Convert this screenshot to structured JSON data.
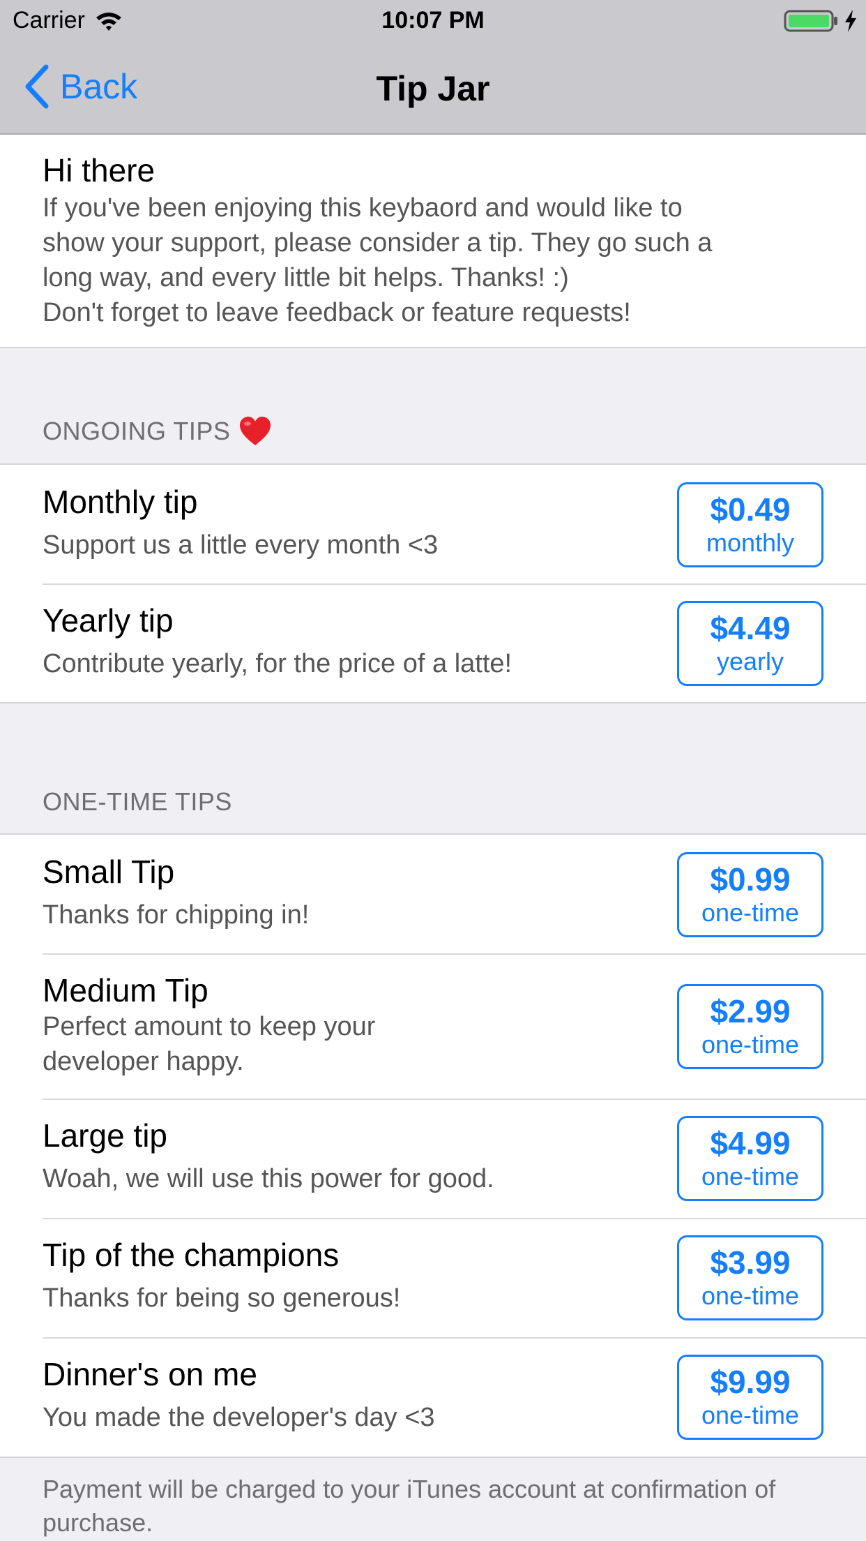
{
  "status_bar": {
    "carrier": "Carrier",
    "time": "10:07 PM",
    "battery_color": "#4cd964"
  },
  "nav": {
    "back_label": "Back",
    "title": "Tip Jar",
    "accent_color": "#147efb"
  },
  "intro": {
    "title": "Hi there",
    "body": "If you've been enjoying this keybaord and would like to\nshow your support, please consider a tip. They go such a\nlong way, and every little bit helps. Thanks! :)\nDon't forget to leave feedback or feature requests!"
  },
  "sections": [
    {
      "header": "ONGOING TIPS",
      "header_icon": "heart-icon",
      "items": [
        {
          "title": "Monthly tip",
          "subtitle": "Support us a little every month <3",
          "price": "$0.49",
          "period": "monthly"
        },
        {
          "title": "Yearly tip",
          "subtitle": "Contribute yearly, for the price of a latte!",
          "price": "$4.49",
          "period": "yearly"
        }
      ]
    },
    {
      "header": "ONE-TIME TIPS",
      "items": [
        {
          "title": "Small Tip",
          "subtitle": "Thanks for chipping in!",
          "price": "$0.99",
          "period": "one-time"
        },
        {
          "title": "Medium Tip",
          "subtitle": "Perfect amount to keep your\ndeveloper happy.",
          "price": "$2.99",
          "period": "one-time"
        },
        {
          "title": "Large tip",
          "subtitle": "Woah, we will use this power for good.",
          "price": "$4.99",
          "period": "one-time"
        },
        {
          "title": "Tip of the champions",
          "subtitle": "Thanks for being so generous!",
          "price": "$3.99",
          "period": "one-time"
        },
        {
          "title": "Dinner's on me",
          "subtitle": "You made the developer's day <3",
          "price": "$9.99",
          "period": "one-time"
        }
      ]
    }
  ],
  "footer": {
    "text": "Payment will be charged to your iTunes account at confirmation of purchase."
  }
}
